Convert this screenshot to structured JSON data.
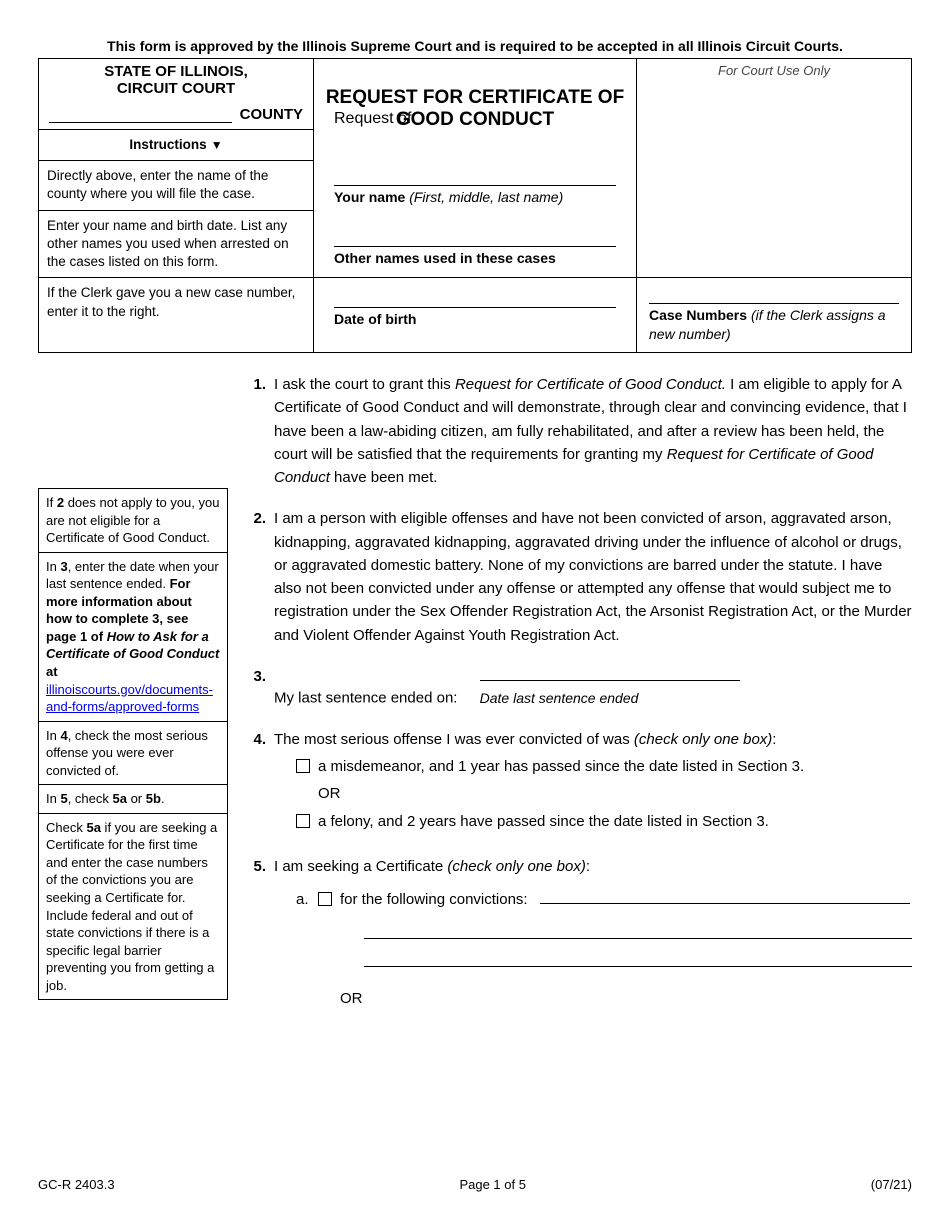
{
  "approval": "This form is approved by the Illinois Supreme Court and is required to be accepted in all Illinois Circuit Courts.",
  "header": {
    "state_line1": "STATE OF ILLINOIS,",
    "state_line2": "CIRCUIT COURT",
    "county_label": "COUNTY",
    "title_line1": "REQUEST FOR CERTIFICATE OF",
    "title_line2": "GOOD CONDUCT",
    "court_use": "For Court Use Only",
    "instructions_label": "Instructions",
    "instr1": "Directly above, enter the name of the county where you will file the case.",
    "instr2": "Enter your name and birth date. List any other names you used when arrested on the cases listed on this form.",
    "instr3": "If the Clerk gave you a new case number, enter it to the right.",
    "request_of": "Request of:",
    "your_name_label": "Your name",
    "your_name_hint": "(First, middle, last name)",
    "other_names_label": "Other names used in these cases",
    "dob_label": "Date of birth",
    "case_numbers_label": "Case Numbers",
    "case_numbers_hint": "(if the Clerk assigns a new number)"
  },
  "side": {
    "s1": "If <b>2</b> does not apply to you, you are not eligible for a Certificate of Good Conduct.",
    "s2_a": "In <b>3</b>, enter the date when your last sentence ended. <b>For more information about how to complete 3, see page 1 of <i>How to Ask for a Certificate of Good Conduct</i> at</b> ",
    "s2_link": "illinoiscourts.gov/documents-and-forms/approved-forms",
    "s3": "In <b>4</b>, check the most serious offense you were ever convicted of.",
    "s4": "In <b>5</b>, check <b>5a</b> or <b>5b</b>.",
    "s5": "Check <b>5a</b> if you are seeking a Certificate for the first time and enter the case numbers of the convictions you are seeking a Certificate for. Include federal and out of state convictions if there is a specific legal barrier preventing you from getting a job."
  },
  "items": {
    "n1": "1.",
    "t1_a": "I ask the court to grant this ",
    "t1_b": "Request for Certificate of Good Conduct.",
    "t1_c": " I am eligible to apply for A Certificate of Good Conduct and will demonstrate, through clear and convincing evidence, that I have been a law-abiding citizen, am fully rehabilitated, and after a review has been held, the court will be satisfied that the requirements for granting my ",
    "t1_d": "Request for Certificate of Good Conduct",
    "t1_e": " have been met.",
    "n2": "2.",
    "t2": "I am a person with eligible offenses and have not been convicted of arson, aggravated arson, kidnapping, aggravated kidnapping, aggravated driving under the influence of alcohol or drugs, or aggravated domestic battery. None of my convictions are barred under the statute.  I have also not been convicted under any offense or attempted any offense that would subject me to registration under the Sex Offender Registration Act, the Arsonist Registration Act, or the Murder and Violent Offender Against Youth Registration Act.",
    "n3": "3.",
    "t3": "My last sentence ended on:",
    "t3_sub": "Date last sentence ended",
    "n4": "4.",
    "t4": "The most serious offense I was ever convicted of was ",
    "t4_hint": "(check only one box)",
    "t4_colon": ":",
    "t4_a": "a misdemeanor, and 1 year has passed since the date listed in Section 3.",
    "t4_or": "OR",
    "t4_b": "a felony, and 2 years have passed since the date listed in Section 3.",
    "n5": "5.",
    "t5": "I am seeking a Certificate ",
    "t5_hint": "(check only one box)",
    "t5_colon": ":",
    "t5_a_letter": "a.",
    "t5_a": "for the following convictions:",
    "t5_or": "OR"
  },
  "footer": {
    "left": "GC-R 2403.3",
    "center": "Page 1 of 5",
    "right": "(07/21)"
  }
}
